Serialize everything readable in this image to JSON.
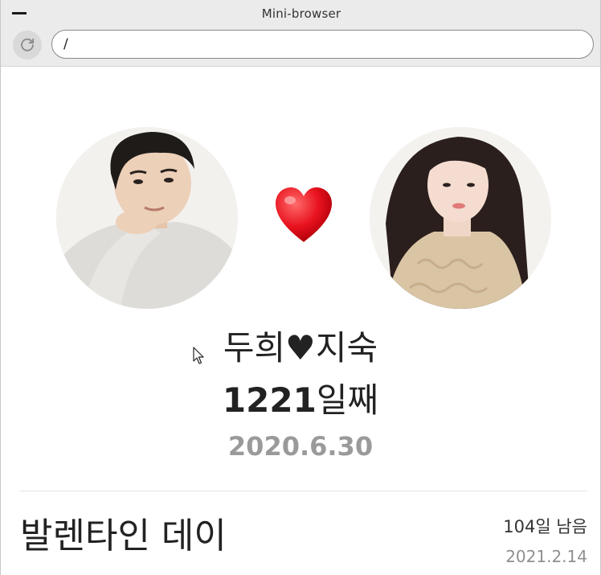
{
  "window": {
    "title": "Mini-browser"
  },
  "toolbar": {
    "url_value": "/"
  },
  "icons": {
    "minimize": "minimize-icon",
    "reload": "reload-icon",
    "heart": "heart-icon",
    "cursor": "mouse-pointer-icon"
  },
  "couple": {
    "names": "두희♥지숙",
    "days_number": "1221",
    "days_suffix": "일째",
    "start_date": "2020.6.30",
    "heart_color": "#e8121e"
  },
  "event": {
    "name": "발렌타인 데이",
    "remaining": "104일 남음",
    "date": "2021.2.14"
  },
  "colors": {
    "chrome_background": "#ebebeb",
    "text_primary": "#222222",
    "text_muted": "#9a9a9a"
  }
}
